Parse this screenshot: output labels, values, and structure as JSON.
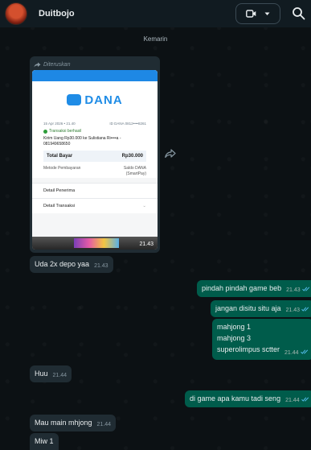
{
  "header": {
    "contact_name": "Duitbojo",
    "video_icon": "video-camera-icon",
    "dropdown_icon": "chevron-down-icon",
    "search_icon": "search-icon"
  },
  "date_divider": "Kemarin",
  "forwarded_image": {
    "forwarded_label": "Diteruskan",
    "time": "21.43",
    "receipt": {
      "brand": "DANA",
      "date": "15 Apr 2026 • 21.40",
      "transaction_id": "ID DANA 0812••••8261",
      "status": "Transaksi berhasil",
      "description": "Kirim Uang Rp30.000 ke Sulistiana Ri••••a - 081949658650",
      "total_label": "Total Bayar",
      "total_value": "Rp30.000",
      "method_label": "Metode Pembayaran",
      "method_value_1": "Saldo DANA",
      "method_value_2": "(SmartPay)",
      "recipient_label": "Detail Penerima",
      "transaction_label": "Detail Transaksi"
    }
  },
  "messages": [
    {
      "direction": "in",
      "text": "Uda 2x depo yaa",
      "time": "21.43"
    },
    {
      "direction": "out",
      "text": "pindah pindah game beb",
      "time": "21.43"
    },
    {
      "direction": "out",
      "text": "jangan disitu situ aja",
      "time": "21.43"
    },
    {
      "direction": "out",
      "text": "mahjong 1\nmahjong 3\nsuperolimpus sctter",
      "time": "21.44"
    },
    {
      "direction": "in",
      "text": "Huu",
      "time": "21.44"
    },
    {
      "direction": "out",
      "text": "di game apa kamu tadi seng",
      "time": "21.44"
    },
    {
      "direction": "in",
      "text": "Mau main mhjong",
      "time": "21.44"
    },
    {
      "direction": "in",
      "text": "Miw 1",
      "time": ""
    }
  ],
  "colors": {
    "header_bg": "#111b21",
    "incoming_bubble": "#202c33",
    "outgoing_bubble": "#005c4b",
    "read_ticks": "#53bdeb",
    "dana_blue": "#1f8ce6"
  }
}
